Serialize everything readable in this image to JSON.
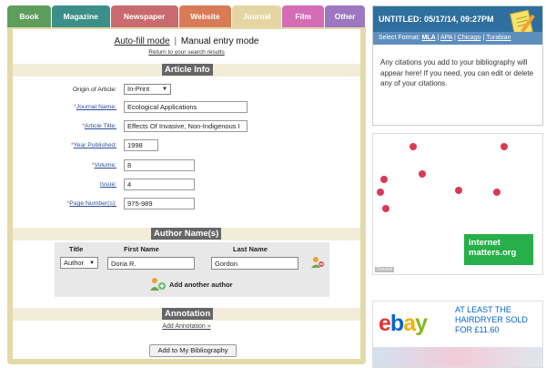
{
  "tabs": [
    {
      "label": "Book",
      "cls": "book"
    },
    {
      "label": "Magazine",
      "cls": "magazine"
    },
    {
      "label": "Newspaper",
      "cls": "newspaper"
    },
    {
      "label": "Website",
      "cls": "website"
    },
    {
      "label": "Journal",
      "cls": "journal"
    },
    {
      "label": "Film",
      "cls": "film"
    },
    {
      "label": "Other",
      "cls": "other"
    }
  ],
  "mode": {
    "auto": "Auto-fill mode",
    "sep": "|",
    "manual": "Manual entry mode",
    "return": "Return to your search results"
  },
  "article_info": {
    "title": "Article Info",
    "origin_label": "Origin of Article:",
    "origin_value": "In-Print",
    "journal_label": "Journal Name:",
    "journal_value": "Ecological Applications",
    "article_label": "Article Title:",
    "article_value": "Effects Of Invasive, Non-Indigenous I",
    "year_label": "Year Published:",
    "year_value": "1998",
    "volume_label": "Volume:",
    "volume_value": "8",
    "issue_label": "Issue:",
    "issue_value": "4",
    "pages_label": "Page Number(s):",
    "pages_value": "975-989"
  },
  "author": {
    "title": "Author Name(s)",
    "col_title": "Title",
    "col_first": "First Name",
    "col_last": "Last Name",
    "title_value": "Author",
    "first_value": "Doria R.",
    "last_value": "Gordon",
    "add_label": "Add another author"
  },
  "annotation": {
    "title": "Annotation",
    "link": "Add Annotation »"
  },
  "add_biblio": "Add to My Bibliography",
  "right": {
    "untitled": "UNTITLED: 05/17/14, 09:27PM",
    "format_label": "Select Format:",
    "formats": [
      "MLA",
      "APA",
      "Chicago",
      "Turabian"
    ],
    "message": "Any citations you add to your bibliography will appear here! If you need, you can edit or delete any of your citations."
  },
  "ad1": {
    "brand": "internet matters.org",
    "source": "Source"
  },
  "ad2": {
    "text": "AT LEAST THE HAIRDRYER SOLD FOR £11.60"
  }
}
